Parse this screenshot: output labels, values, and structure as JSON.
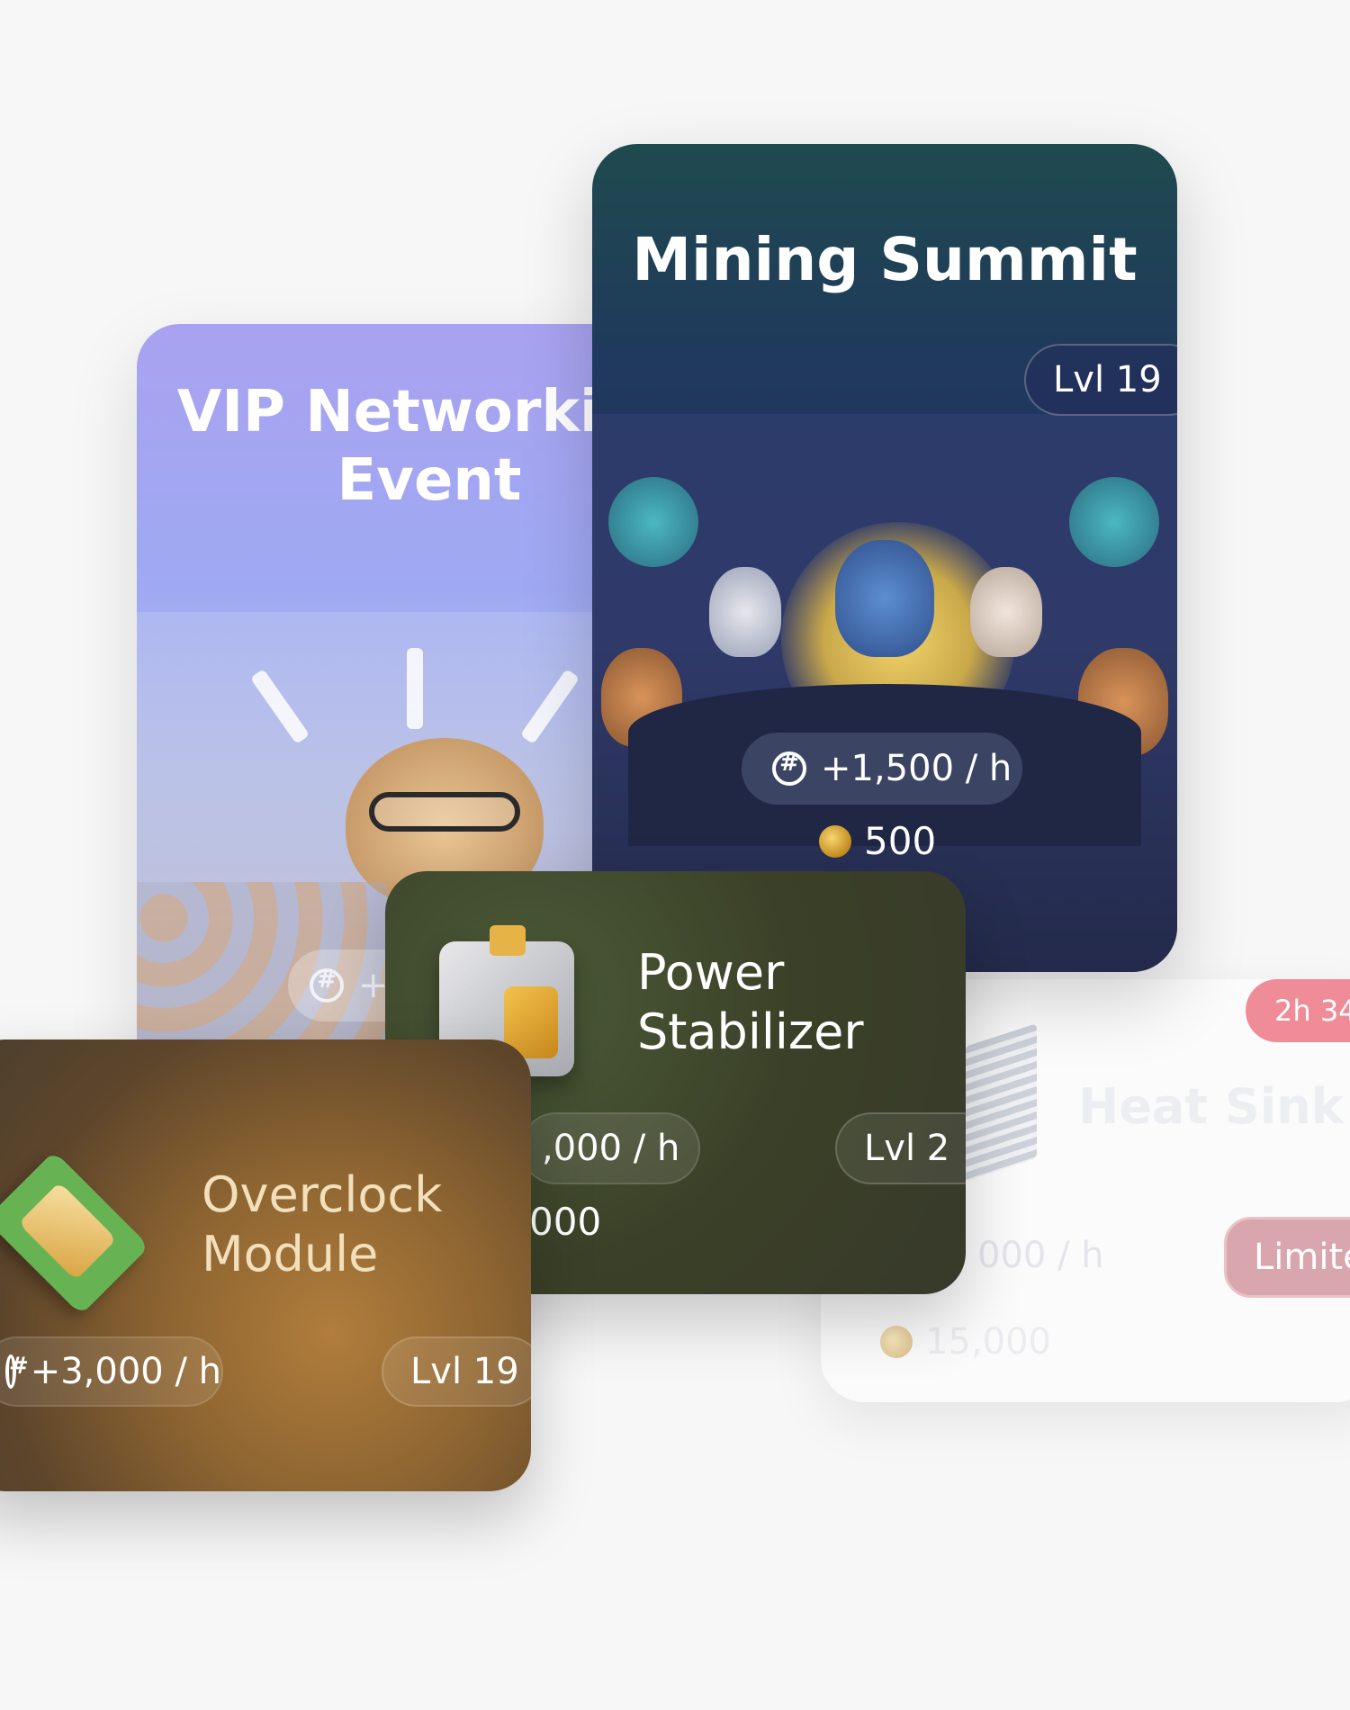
{
  "cards": {
    "vip": {
      "title": "VIP Networking Event",
      "rate": "+",
      "colors": {
        "top": "#a9a2f0",
        "bottom": "#c9cce0"
      }
    },
    "summit": {
      "title": "Mining Summit",
      "level": "Lvl 19",
      "rate": "+1,500 / h",
      "cost": "500",
      "colors": {
        "top": "#1f4a4e",
        "bottom": "#2b3150"
      }
    },
    "heat": {
      "title": "Heat Sink",
      "timer": "2h 34",
      "rate": "000 / h",
      "badge": "Limite",
      "cost": "15,000",
      "colors": {
        "badge": "#f08c97",
        "limited": "#d9a6ad"
      }
    },
    "power": {
      "title_line1": "Power",
      "title_line2": "Stabilizer",
      "rate": ",000 / h",
      "level": "Lvl 2",
      "cost": "000",
      "colors": {
        "bg": "#3b4128"
      }
    },
    "overclock": {
      "title_line1": "Overclock",
      "title_line2": "Module",
      "rate": "+3,000 / h",
      "level": "Lvl 19",
      "colors": {
        "bg": "#8e6531",
        "title": "#f2dfbb"
      }
    }
  },
  "icons": {
    "rate": "hash-coin-icon",
    "coin": "coin-icon"
  }
}
